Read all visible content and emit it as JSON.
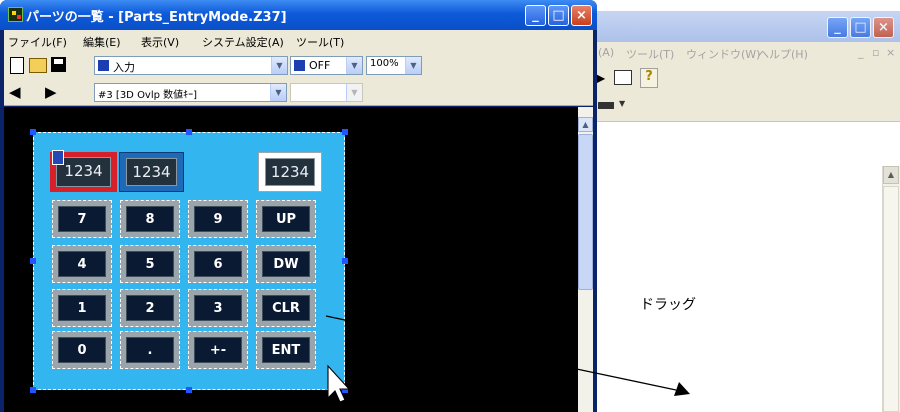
{
  "background_window": {
    "menu": [
      "(A)",
      "ツール(T)",
      "ウィンドウ(W)",
      "ヘルプ(H)"
    ],
    "drag_label": "ドラッグ"
  },
  "main_window": {
    "title": "パーツの一覧 - [Parts_EntryMode.Z37]",
    "menu": [
      "ファイル(F)",
      "編集(E)",
      "表示(V)",
      "システム設定(A)",
      "ツール(T)"
    ],
    "toolbar": {
      "mode_select": "入力",
      "state_select": "OFF",
      "zoom_select": "100%",
      "part_select": "#3 [3D Ovlp 数値ｷｰ]",
      "extra_select": ""
    }
  },
  "keypad": {
    "displays": [
      "1234",
      "1234",
      "1234"
    ],
    "keys": [
      "7",
      "8",
      "9",
      "UP",
      "4",
      "5",
      "6",
      "DW",
      "1",
      "2",
      "3",
      "CLR",
      "0",
      ".",
      "+-",
      "ENT"
    ]
  },
  "colors": {
    "keypad_background": "#33b6f0",
    "key_face": "#0b1a33",
    "selection_handle": "#1f56ff",
    "titlebar": "#0d5ad9"
  }
}
